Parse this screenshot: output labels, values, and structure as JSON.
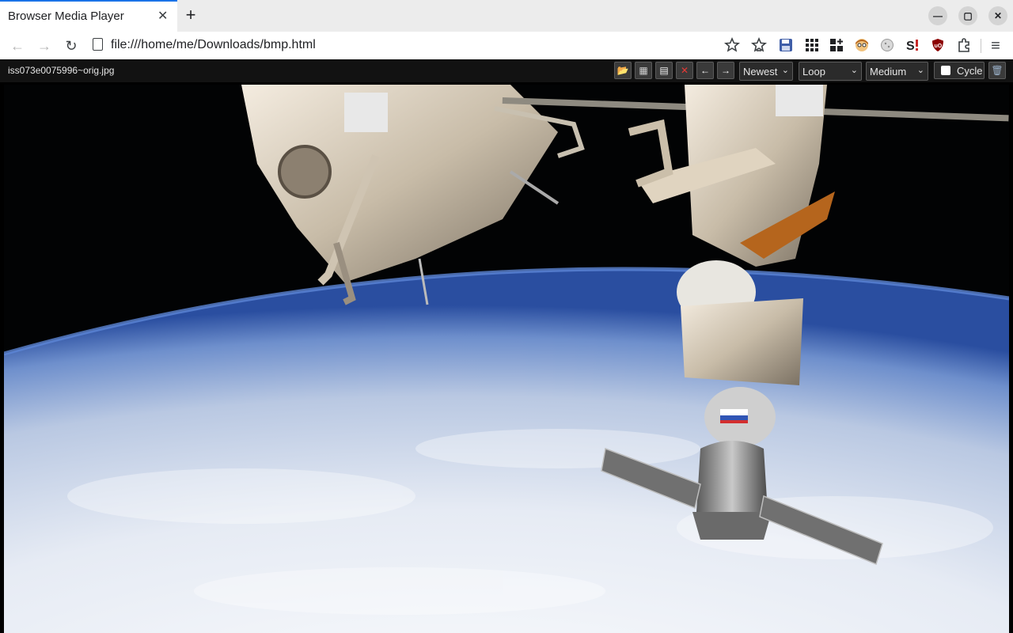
{
  "browser": {
    "tab_title": "Browser Media Player",
    "tab_close_glyph": "✕",
    "new_tab_glyph": "+",
    "url": "file:///home/me/Downloads/bmp.html",
    "window_buttons": [
      "—",
      "▢",
      "✕"
    ],
    "nav_glyphs": {
      "back": "←",
      "forward": "→",
      "reload": "↻"
    },
    "menu_glyph": "≡"
  },
  "extensions": [
    {
      "name": "bookmark-star-icon",
      "color": "#3c4043"
    },
    {
      "name": "reading-list-icon",
      "color": "#3c4043"
    },
    {
      "name": "save-disk-icon",
      "color": "#3f5ea8"
    },
    {
      "name": "apps-grid-icon",
      "color": "#202124"
    },
    {
      "name": "apps-plus-icon",
      "color": "#202124"
    },
    {
      "name": "face-extension-icon",
      "color": "#e8a35a"
    },
    {
      "name": "cookie-extension-icon",
      "color": "#b8b8b8"
    },
    {
      "name": "s-extension-icon",
      "color": "#c62828"
    },
    {
      "name": "ublock-shield-icon",
      "color": "#8b0000"
    },
    {
      "name": "extensions-puzzle-icon",
      "color": "#3c4043"
    }
  ],
  "player": {
    "filename": "iss073e0075996~orig.jpg",
    "buttons": [
      {
        "name": "open-folder-button",
        "glyph": "📂",
        "color": "#2f8fe0"
      },
      {
        "name": "grid-view-button",
        "glyph": "▦",
        "color": "#d0d0d0"
      },
      {
        "name": "playlist-button",
        "glyph": "▤",
        "color": "#f2f2f2"
      },
      {
        "name": "delete-button",
        "glyph": "✕",
        "color": "#e53935"
      },
      {
        "name": "previous-button",
        "glyph": "←",
        "color": "#ffffff"
      },
      {
        "name": "next-button",
        "glyph": "→",
        "color": "#ffffff"
      }
    ],
    "sort_select": "Newest",
    "loop_select": "Loop",
    "size_select": "Medium",
    "cycle_label": "Cycle",
    "trash_glyph": "🗑"
  }
}
